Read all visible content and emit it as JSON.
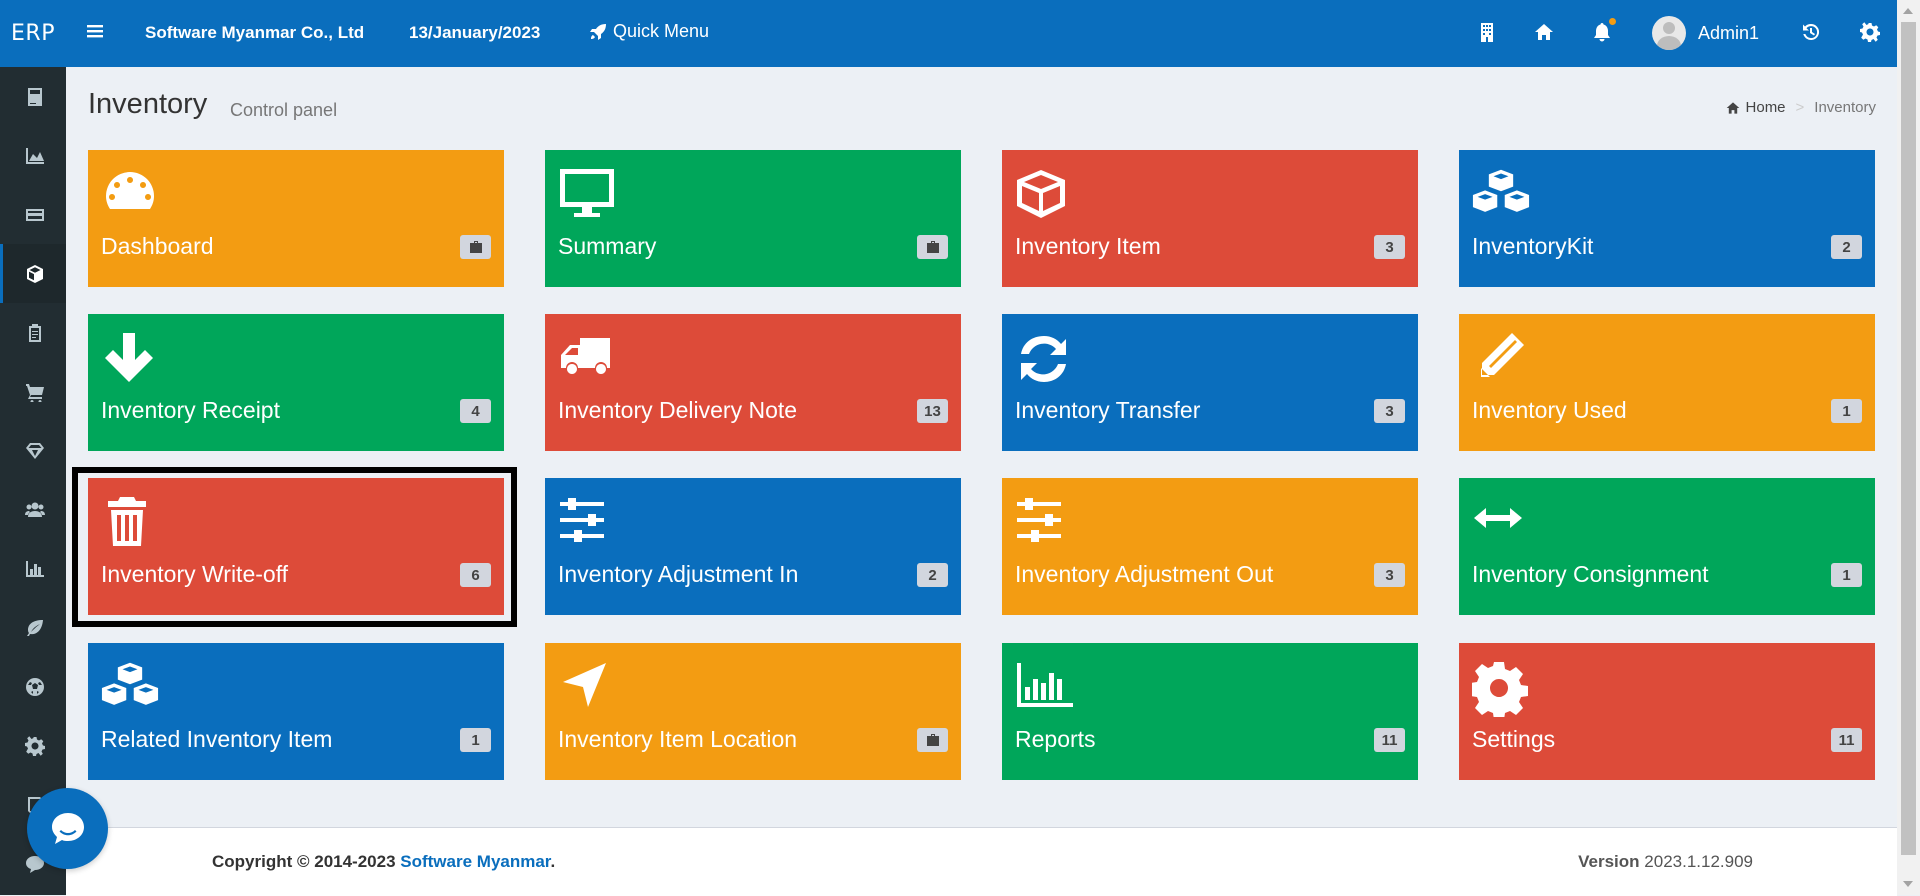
{
  "brand": "ERP",
  "topbar": {
    "company": "Software Myanmar Co., Ltd",
    "date": "13/January/2023",
    "quick_menu": "Quick Menu",
    "username": "Admin1"
  },
  "sidebar": {
    "items": [
      {
        "icon": "calculator-icon"
      },
      {
        "icon": "area-chart-icon"
      },
      {
        "icon": "credit-card-icon"
      },
      {
        "icon": "cube-icon",
        "active": true
      },
      {
        "icon": "clipboard-icon"
      },
      {
        "icon": "shopping-cart-icon"
      },
      {
        "icon": "diamond-icon"
      },
      {
        "icon": "users-icon"
      },
      {
        "icon": "bar-chart-icon"
      },
      {
        "icon": "leaf-icon"
      },
      {
        "icon": "soccer-ball-icon"
      },
      {
        "icon": "gear-icon"
      },
      {
        "icon": "book-icon"
      },
      {
        "icon": "comment-icon"
      }
    ]
  },
  "page": {
    "title": "Inventory",
    "subtitle": "Control panel",
    "breadcrumb_home": "Home",
    "breadcrumb_current": "Inventory"
  },
  "tiles": [
    {
      "label": "Dashboard",
      "badge": "",
      "badge_icon": "briefcase-icon",
      "icon": "tachometer-icon",
      "color": "#f39c12"
    },
    {
      "label": "Summary",
      "badge": "",
      "badge_icon": "briefcase-icon",
      "icon": "desktop-icon",
      "color": "#00a65a"
    },
    {
      "label": "Inventory Item",
      "badge": "3",
      "icon": "cube-icon",
      "color": "#dd4b39"
    },
    {
      "label": "InventoryKit",
      "badge": "2",
      "icon": "cubes-icon",
      "color": "#0a6ebd"
    },
    {
      "label": "Inventory Receipt",
      "badge": "4",
      "icon": "arrow-down-icon",
      "color": "#00a65a"
    },
    {
      "label": "Inventory Delivery Note",
      "badge": "13",
      "icon": "truck-icon",
      "color": "#dd4b39"
    },
    {
      "label": "Inventory Transfer",
      "badge": "3",
      "icon": "refresh-icon",
      "color": "#0a6ebd"
    },
    {
      "label": "Inventory Used",
      "badge": "1",
      "icon": "pencil-icon",
      "color": "#f39c12"
    },
    {
      "label": "Inventory Write-off",
      "badge": "6",
      "icon": "trash-icon",
      "color": "#dd4b39"
    },
    {
      "label": "Inventory Adjustment In",
      "badge": "2",
      "icon": "sliders-icon",
      "color": "#0a6ebd"
    },
    {
      "label": "Inventory Adjustment Out",
      "badge": "3",
      "icon": "sliders-icon",
      "color": "#f39c12"
    },
    {
      "label": "Inventory Consignment",
      "badge": "1",
      "icon": "arrows-h-icon",
      "color": "#00a65a"
    },
    {
      "label": "Related Inventory Item",
      "badge": "1",
      "icon": "cubes-icon",
      "color": "#0a6ebd"
    },
    {
      "label": "Inventory Item Location",
      "badge": "",
      "badge_icon": "briefcase-icon",
      "icon": "location-arrow-icon",
      "color": "#f39c12"
    },
    {
      "label": "Reports",
      "badge": "11",
      "icon": "bar-chart-icon",
      "color": "#00a65a"
    },
    {
      "label": "Settings",
      "badge": "11",
      "icon": "gear-icon",
      "color": "#dd4b39"
    }
  ],
  "footer": {
    "copyright_prefix": "Copyright © 2014-2023 ",
    "copyright_link": "Software Myanmar",
    "copyright_suffix": ".",
    "version_label": "Version",
    "version_value": "2023.1.12.909"
  },
  "colors": {
    "primary": "#0a6ebd",
    "orange": "#f39c12",
    "green": "#00a65a",
    "red": "#dd4b39",
    "sidebar": "#222d32"
  }
}
